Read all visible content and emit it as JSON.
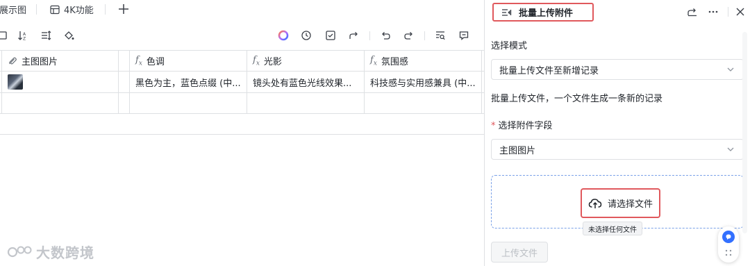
{
  "tabs": [
    {
      "label": "展示图"
    },
    {
      "label": "4K功能"
    }
  ],
  "table": {
    "headers": [
      "主图图片",
      "色调",
      "光影",
      "氛围感"
    ],
    "rows": [
      [
        "",
        "黑色为主，蓝色点缀 (中...",
        "镜头处有蓝色光线效果...",
        "科技感与实用感兼具 (中..."
      ]
    ]
  },
  "watermark": "大数跨境",
  "panel": {
    "title": "批量上传附件",
    "mode_label": "选择模式",
    "mode_value": "批量上传文件至新增记录",
    "description": "批量上传文件，一个文件生成一条新的记录",
    "field_required_mark": "*",
    "field_label": "选择附件字段",
    "field_value": "主图图片",
    "choose_file_label": "请选择文件",
    "no_file_tooltip": "未选择任何文件",
    "submit_label": "上传文件"
  },
  "colors": {
    "highlight_border": "#e0585c",
    "accent_blue": "#3370ff",
    "border": "#dee0e3"
  }
}
